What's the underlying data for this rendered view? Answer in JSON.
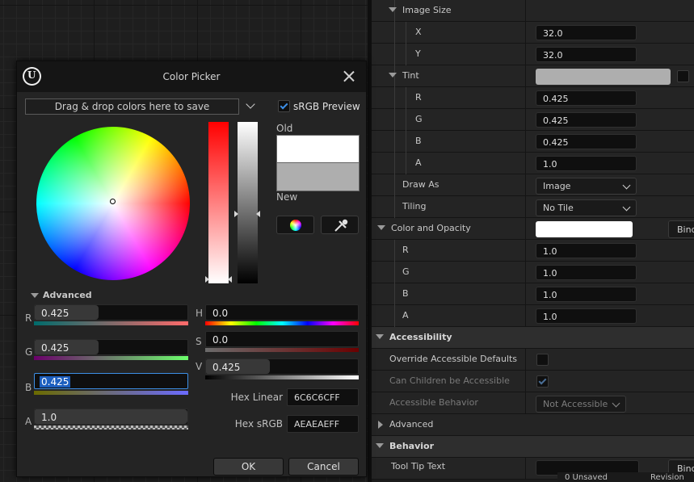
{
  "picker": {
    "title": "Color Picker",
    "themes_placeholder": "Drag & drop colors here to save",
    "srgb_preview_label": "sRGB Preview",
    "srgb_preview_checked": true,
    "old_label": "Old",
    "new_label": "New",
    "old_color": "#FFFFFF",
    "new_color": "#AEAEAE",
    "advanced_label": "Advanced",
    "channels": {
      "r": {
        "label": "R",
        "value": "0.425"
      },
      "g": {
        "label": "G",
        "value": "0.425"
      },
      "b": {
        "label": "B",
        "value": "0.425"
      },
      "a": {
        "label": "A",
        "value": "1.0"
      },
      "h": {
        "label": "H",
        "value": "0.0"
      },
      "s": {
        "label": "S",
        "value": "0.0"
      },
      "v": {
        "label": "V",
        "value": "0.425"
      }
    },
    "hex_linear_label": "Hex Linear",
    "hex_linear_value": "6C6C6CFF",
    "hex_srgb_label": "Hex sRGB",
    "hex_srgb_value": "AEAEAEFF",
    "ok_label": "OK",
    "cancel_label": "Cancel"
  },
  "details": {
    "image_size": {
      "label": "Image Size",
      "x_label": "X",
      "x_value": "32.0",
      "y_label": "Y",
      "y_value": "32.0"
    },
    "tint": {
      "label": "Tint",
      "swatch_color": "#AEAEAE",
      "r_label": "R",
      "r_value": "0.425",
      "g_label": "G",
      "g_value": "0.425",
      "b_label": "B",
      "b_value": "0.425",
      "a_label": "A",
      "a_value": "1.0"
    },
    "draw_as": {
      "label": "Draw As",
      "value": "Image"
    },
    "tiling": {
      "label": "Tiling",
      "value": "No Tile"
    },
    "color_and_opacity": {
      "label": "Color and Opacity",
      "swatch_color": "#FFFFFF",
      "bind_label": "Bind",
      "r_label": "R",
      "r_value": "1.0",
      "g_label": "G",
      "g_value": "1.0",
      "b_label": "B",
      "b_value": "1.0",
      "a_label": "A",
      "a_value": "1.0"
    },
    "accessibility": {
      "label": "Accessibility",
      "override_label": "Override Accessible Defaults",
      "override_checked": false,
      "children_label": "Can Children be Accessible",
      "children_checked": true,
      "behavior_label": "Accessible Behavior",
      "behavior_value": "Not Accessible"
    },
    "advanced_label": "Advanced",
    "behavior": {
      "label": "Behavior",
      "tooltip_label": "Tool Tip Text",
      "bind_label": "Bind"
    }
  },
  "statusbar": {
    "item1": "0 Unsaved",
    "item2": "Revision"
  }
}
